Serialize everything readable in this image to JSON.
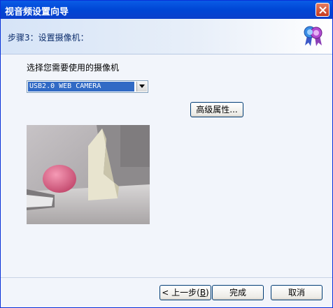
{
  "window": {
    "title": "视音频设置向导"
  },
  "header": {
    "step_title": "步骤3：设置摄像机：",
    "icon": "award-ribbon-icon"
  },
  "main": {
    "prompt": "选择您需要使用的摄像机",
    "camera_select": {
      "value": "USB2.0 WEB CAMERA"
    },
    "advanced_button": "高级属性...",
    "preview": "camera-preview-image"
  },
  "footer": {
    "back_label": "< 上一步",
    "back_mnemonic": "B",
    "finish_label": "完成",
    "cancel_label": "取消"
  }
}
